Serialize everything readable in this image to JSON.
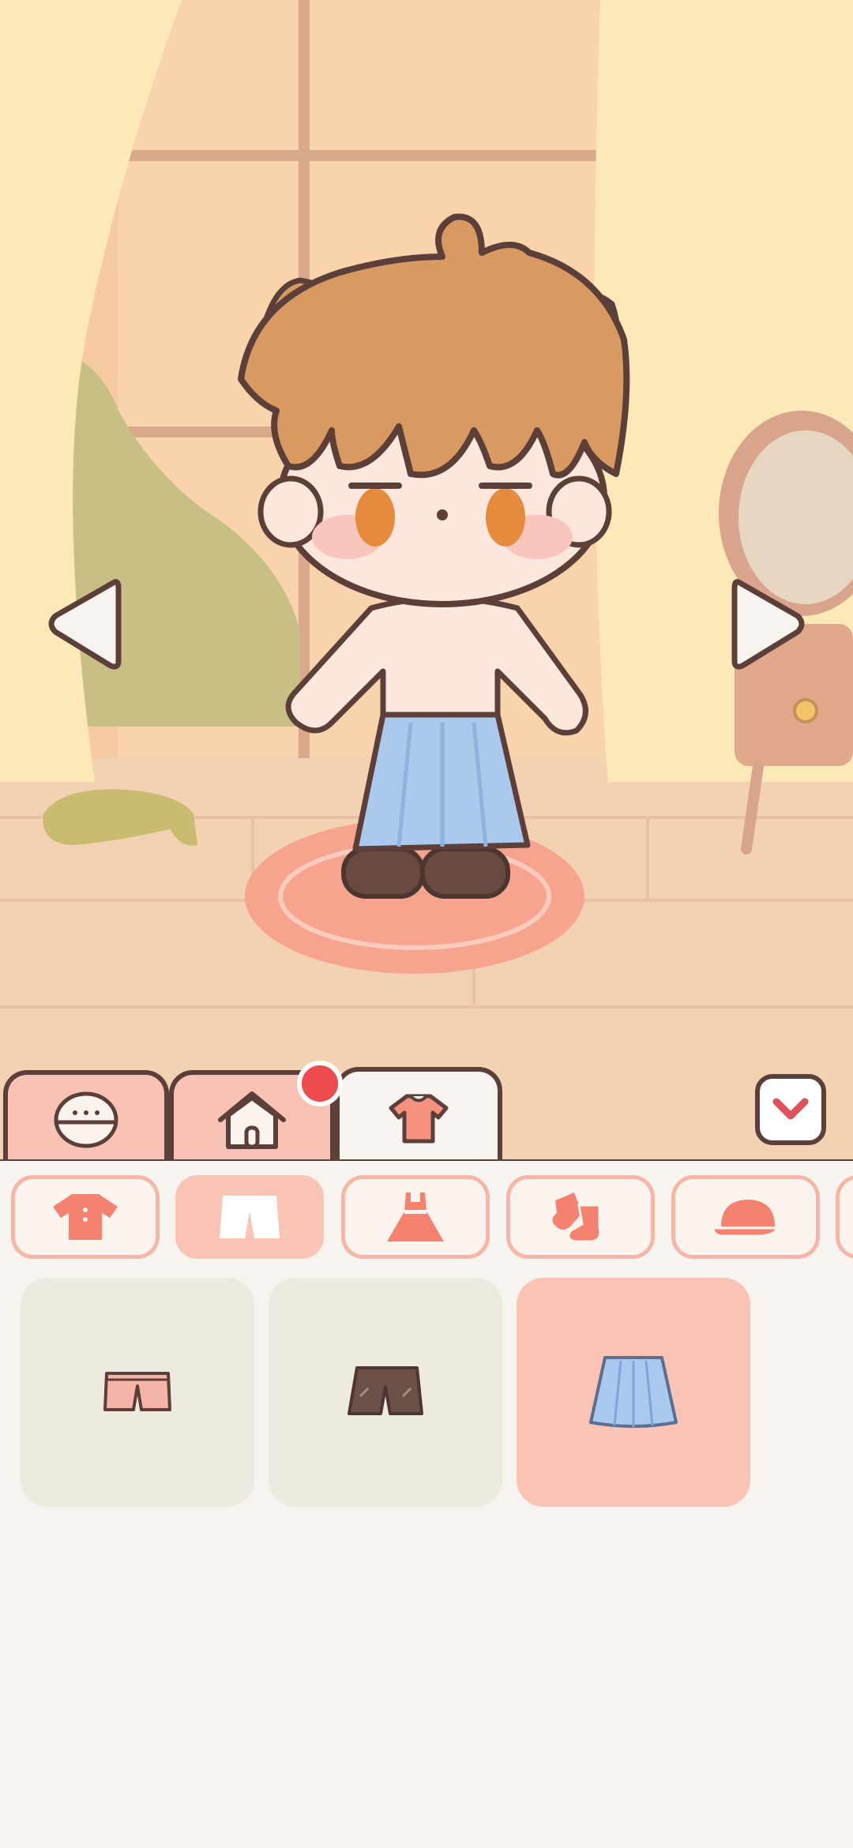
{
  "scene": {
    "name": "bedroom",
    "colors": {
      "wall": "#f6cba2",
      "curtain": "#fde8b8",
      "floor": "#f3d2b4",
      "rug": "#f7a48f"
    },
    "character": {
      "hair_color": "#d89a61",
      "eye_color": "#e58b3b",
      "skirt_color": "#aac9ec",
      "shoe_color": "#6a4a40"
    },
    "nav": {
      "prev_icon": "triangle-left-icon",
      "next_icon": "triangle-right-icon"
    }
  },
  "tabs": [
    {
      "name": "character",
      "icon": "face-icon",
      "active": false
    },
    {
      "name": "room",
      "icon": "house-icon",
      "active": false,
      "has_notification": true
    },
    {
      "name": "wardrobe",
      "icon": "shirt-icon",
      "active": true
    }
  ],
  "collapse_icon": "chevron-down-icon",
  "categories": [
    {
      "name": "tops",
      "icon": "tshirt-icon",
      "active": false
    },
    {
      "name": "bottoms",
      "icon": "shorts-icon",
      "active": true
    },
    {
      "name": "dresses",
      "icon": "dress-icon",
      "active": false
    },
    {
      "name": "socks",
      "icon": "socks-icon",
      "active": false
    },
    {
      "name": "hats",
      "icon": "hat-icon",
      "active": false
    }
  ],
  "items": [
    {
      "name": "pink-shorts",
      "color": "#f6b4a8",
      "selected": false
    },
    {
      "name": "brown-shorts",
      "color": "#6d5048",
      "selected": false
    },
    {
      "name": "blue-pleated-skirt",
      "color": "#a9c9ee",
      "selected": true
    }
  ],
  "colors": {
    "accent": "#f9c3b6",
    "outline": "#5b3f38",
    "notification": "#ee4b4e",
    "panel": "#f7f3ee"
  }
}
